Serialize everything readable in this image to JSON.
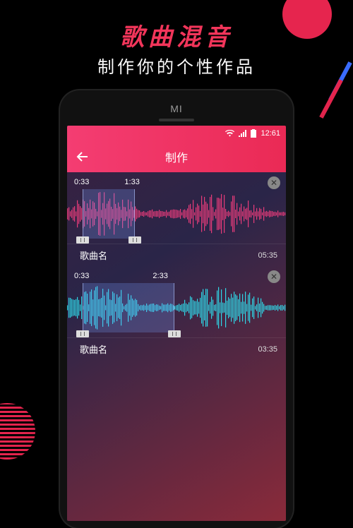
{
  "promo": {
    "title": "歌曲混音",
    "subtitle": "制作你的个性作品"
  },
  "phone": {
    "brand": "MI"
  },
  "statusbar": {
    "time": "12:61"
  },
  "appbar": {
    "title": "制作"
  },
  "tracks": [
    {
      "start_label": "0:33",
      "end_label": "1:33",
      "song_name": "歌曲名",
      "duration": "05:35",
      "color": "#e83b7a",
      "sel_left_pct": 7,
      "sel_width_pct": 24
    },
    {
      "start_label": "0:33",
      "end_label": "2:33",
      "song_name": "歌曲名",
      "duration": "03:35",
      "color": "#2fd6e6",
      "sel_left_pct": 7,
      "sel_width_pct": 42
    }
  ]
}
